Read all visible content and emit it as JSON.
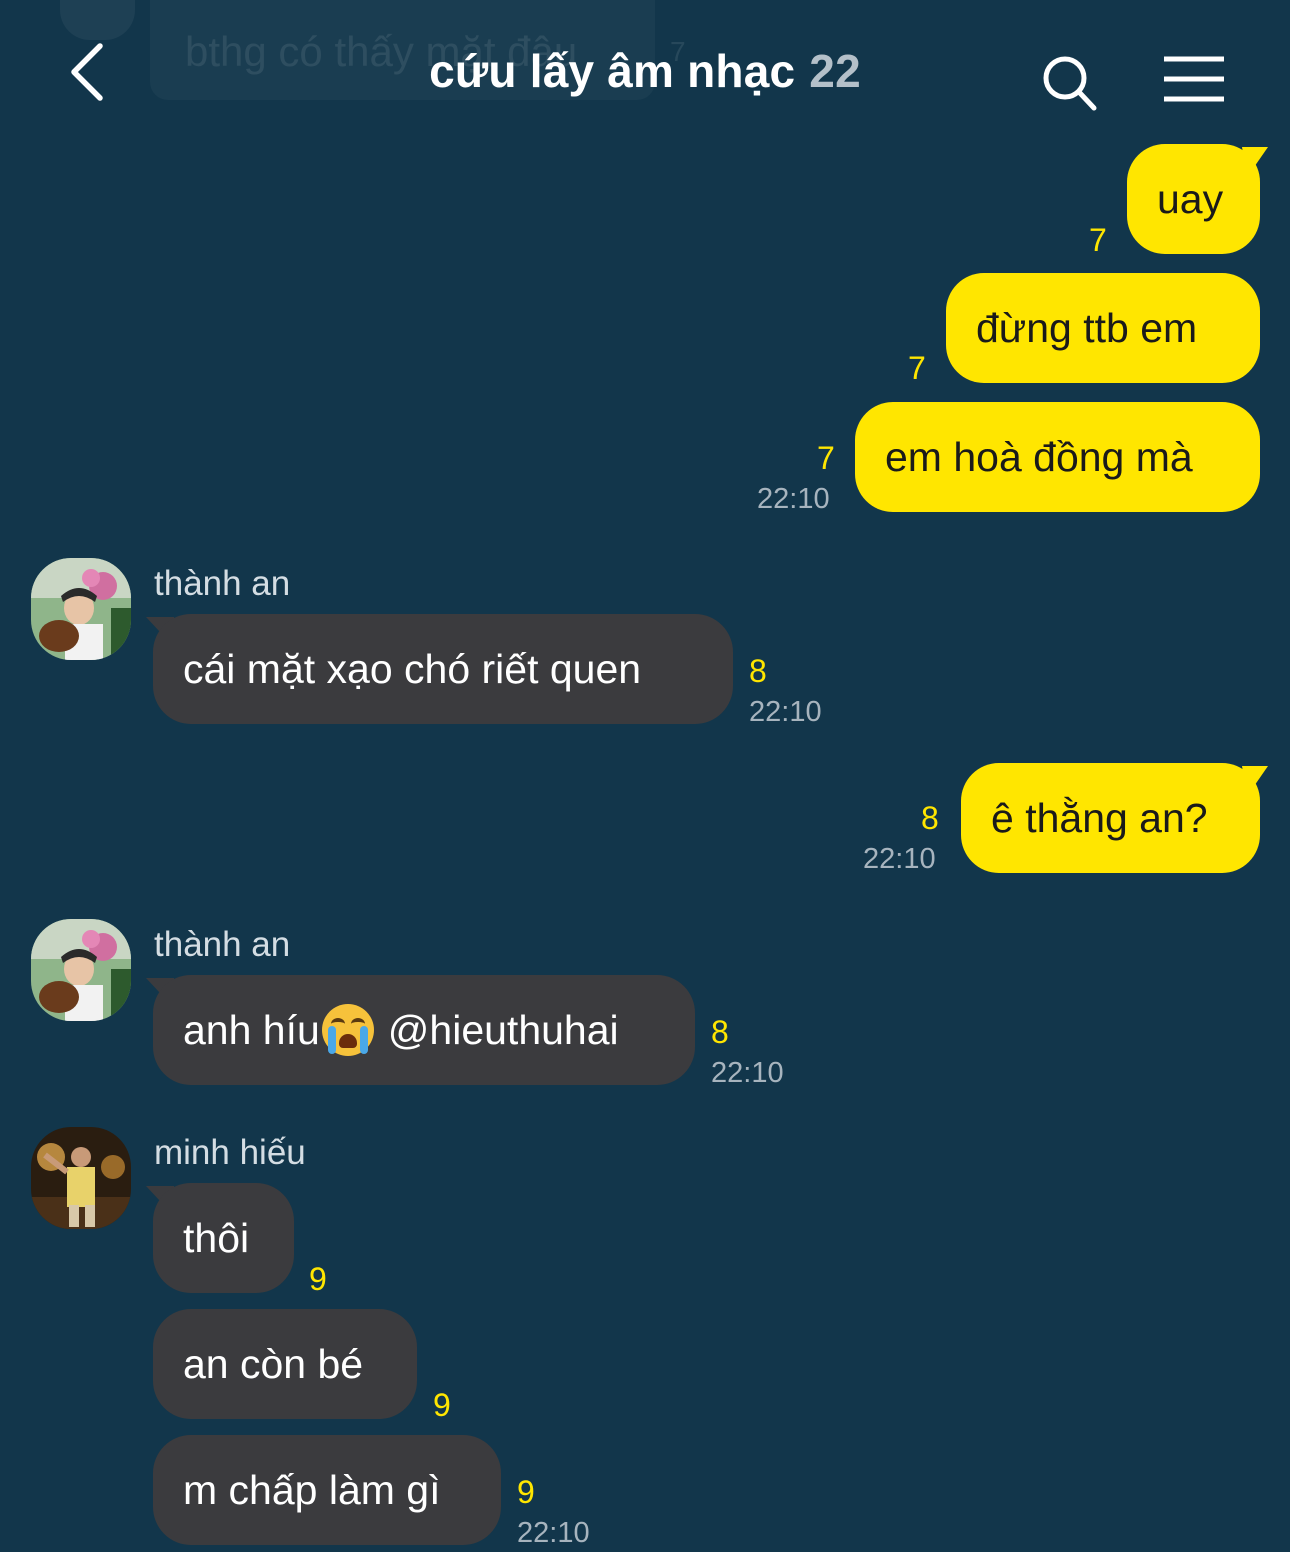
{
  "ghost": {
    "text": "bthg có thấy mặt đâu",
    "num": "7"
  },
  "header": {
    "title": "cứu lấy âm nhạc",
    "member_count": "22",
    "back_icon": "chevron-left-icon",
    "search_icon": "search-icon",
    "menu_icon": "hamburger-menu-icon"
  },
  "colors": {
    "background": "#12364b",
    "outgoing": "#ffe600",
    "incoming": "#3b3b3e",
    "unread": "#ffe600"
  },
  "messages": [
    {
      "dir": "out",
      "text": "uay",
      "unread": "7"
    },
    {
      "dir": "out",
      "text": "đừng ttb em",
      "unread": "7"
    },
    {
      "dir": "out",
      "text": "em hoà đồng mà",
      "unread": "7",
      "time": "22:10"
    },
    {
      "dir": "in",
      "sender": "thành an",
      "text": "cái mặt xạo chó riết quen",
      "unread": "8",
      "time": "22:10"
    },
    {
      "dir": "out",
      "text": "ê thằng an?",
      "unread": "8",
      "time": "22:10"
    },
    {
      "dir": "in",
      "sender": "thành an",
      "text_before": "anh híu",
      "emoji": "loudly-crying-face",
      "text_after": "@hieuthuhai",
      "unread": "8",
      "time": "22:10"
    },
    {
      "dir": "in",
      "sender": "minh hiếu",
      "text": "thôi",
      "unread": "9"
    },
    {
      "dir": "in",
      "text": "an còn bé",
      "unread": "9"
    },
    {
      "dir": "in",
      "text": "m chấp làm gì",
      "unread": "9",
      "time": "22:10"
    }
  ]
}
